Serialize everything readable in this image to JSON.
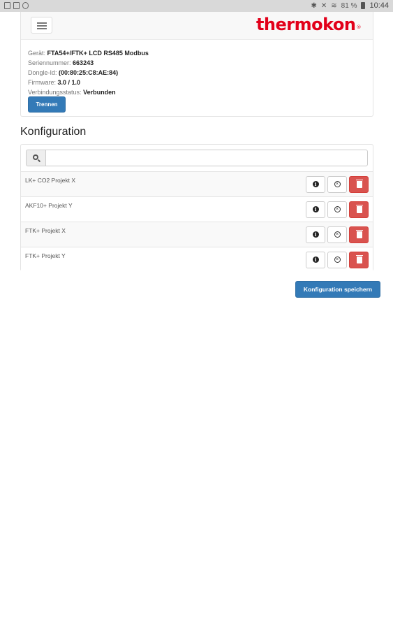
{
  "status_bar": {
    "battery": "81 %",
    "time": "10:44"
  },
  "header": {
    "logo_text": "thermokon",
    "logo_mark": "®"
  },
  "device": {
    "rows": [
      {
        "label": "Gerät:",
        "value": "FTA54+/FTK+ LCD RS485 Modbus"
      },
      {
        "label": "Seriennummer:",
        "value": "663243"
      },
      {
        "label": "Dongle-Id:",
        "value": "(00:80:25:C8:AE:84)"
      },
      {
        "label": "Firmware:",
        "value": "3.0 / 1.0"
      },
      {
        "label": "Verbindungsstatus:",
        "value": "Verbunden"
      }
    ],
    "disconnect_label": "Trennen"
  },
  "config": {
    "title": "Konfiguration",
    "search_placeholder": "",
    "items": [
      {
        "name": "LK+ CO2 Projekt X"
      },
      {
        "name": "AKF10+ Projekt Y"
      },
      {
        "name": "FTK+ Projekt X"
      },
      {
        "name": "FTK+ Projekt Y"
      }
    ],
    "save_label": "Konfiguration speichern"
  },
  "colors": {
    "brand": "#e2001a",
    "primary": "#337ab7",
    "danger": "#d9534f"
  },
  "icons": {
    "menu": "hamburger-icon",
    "search": "search-icon",
    "info": "info-icon",
    "remove": "x-circle-icon",
    "delete": "trash-icon"
  }
}
